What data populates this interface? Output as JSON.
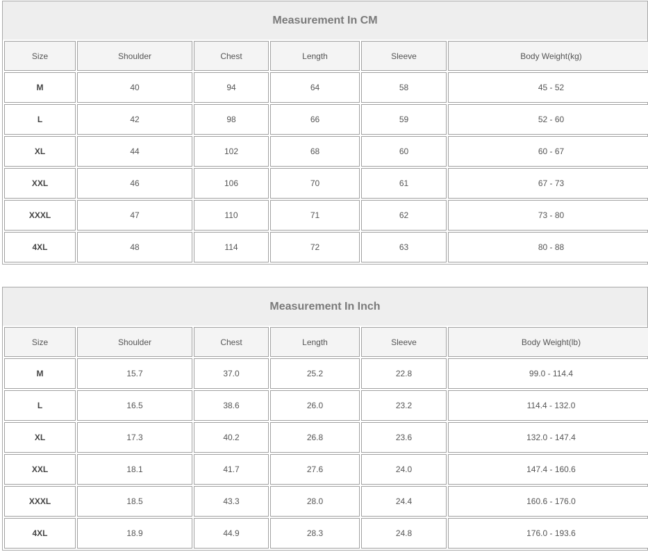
{
  "tables": [
    {
      "title": "Measurement In CM",
      "headers": [
        "Size",
        "Shoulder",
        "Chest",
        "Length",
        "Sleeve",
        "Body Weight(kg)"
      ],
      "rows": [
        [
          "M",
          "40",
          "94",
          "64",
          "58",
          "45 - 52"
        ],
        [
          "L",
          "42",
          "98",
          "66",
          "59",
          "52 - 60"
        ],
        [
          "XL",
          "44",
          "102",
          "68",
          "60",
          "60 - 67"
        ],
        [
          "XXL",
          "46",
          "106",
          "70",
          "61",
          "67 - 73"
        ],
        [
          "XXXL",
          "47",
          "110",
          "71",
          "62",
          "73 - 80"
        ],
        [
          "4XL",
          "48",
          "114",
          "72",
          "63",
          "80 - 88"
        ]
      ]
    },
    {
      "title": "Measurement In Inch",
      "headers": [
        "Size",
        "Shoulder",
        "Chest",
        "Length",
        "Sleeve",
        "Body Weight(lb)"
      ],
      "rows": [
        [
          "M",
          "15.7",
          "37.0",
          "25.2",
          "22.8",
          "99.0 - 114.4"
        ],
        [
          "L",
          "16.5",
          "38.6",
          "26.0",
          "23.2",
          "114.4 - 132.0"
        ],
        [
          "XL",
          "17.3",
          "40.2",
          "26.8",
          "23.6",
          "132.0 - 147.4"
        ],
        [
          "XXL",
          "18.1",
          "41.7",
          "27.6",
          "24.0",
          "147.4 - 160.6"
        ],
        [
          "XXXL",
          "18.5",
          "43.3",
          "28.0",
          "24.4",
          "160.6 - 176.0"
        ],
        [
          "4XL",
          "18.9",
          "44.9",
          "28.3",
          "24.8",
          "176.0 - 193.6"
        ]
      ]
    }
  ]
}
